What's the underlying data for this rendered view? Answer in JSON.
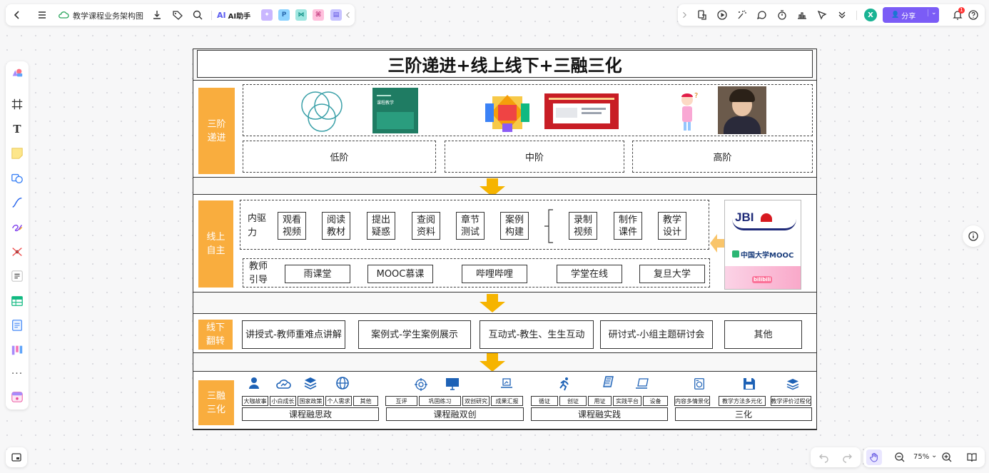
{
  "toolbar_left": {
    "doc_title": "教学课程业务架构图",
    "ai_label": "AI助手"
  },
  "toolbar_right": {
    "avatar_letter": "X",
    "share_label": "分享",
    "notification_count": "1"
  },
  "zoom": {
    "level": "75%"
  },
  "diagram": {
    "title": "三阶递进+线上线下+三融三化",
    "section1": {
      "label": "三阶\n递进",
      "levels": [
        "低阶",
        "中阶",
        "高阶"
      ],
      "book_text": "课程教学"
    },
    "section2": {
      "label": "线上\n自主",
      "drive_label": "内驱\n力",
      "drive_items": [
        "观看\n视频",
        "阅读\n教材",
        "提出\n疑惑",
        "查阅\n资料",
        "章节\n测试",
        "案例\n构建"
      ],
      "teacher_items": [
        "录制\n视频",
        "制作\n课件",
        "教学\n设计"
      ],
      "guide_label": "教师\n引导",
      "platforms": [
        "雨课堂",
        "MOOC慕课",
        "哔哩哔哩",
        "学堂在线",
        "复旦大学"
      ],
      "logos": {
        "jbi": "JBI",
        "mooc": "中国大学MOOC",
        "bili": "bilibili"
      }
    },
    "section3": {
      "label": "线下\n翻转",
      "modes": [
        "讲授式-教师重难点讲解",
        "案例式-学生案例展示",
        "互动式-教生、生生互动",
        "研讨式-小组主题研讨会",
        "其他"
      ]
    },
    "section4": {
      "label": "三融\n三化",
      "groups": [
        {
          "items": [
            "大咖故事",
            "小白成长",
            "国家政策",
            "个人需求",
            "其他"
          ],
          "title": "课程融思政"
        },
        {
          "items": [
            "互评",
            "巩固练习",
            "双创研究",
            "成果汇报"
          ],
          "title": "课程融双创"
        },
        {
          "items": [
            "循证",
            "创证",
            "用证",
            "实践平台",
            "设备"
          ],
          "title": "课程融实践"
        },
        {
          "items": [
            "内容多情景化",
            "教学方法多元化",
            "教学评价过程化"
          ],
          "title": "三化"
        }
      ]
    }
  },
  "colors": {
    "orange": "#f9ad3e",
    "arrow": "#f6b400",
    "share_purple": "#7b5cf6"
  }
}
